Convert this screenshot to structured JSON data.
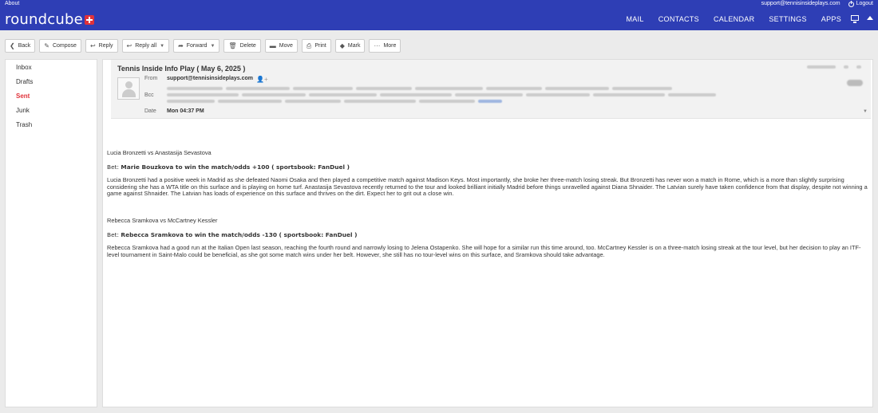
{
  "topbar": {
    "about": "About",
    "user_email": "support@tennisinsideplays.com",
    "logout": "Logout"
  },
  "header": {
    "logo": "roundcube",
    "nav": [
      "MAIL",
      "CONTACTS",
      "CALENDAR",
      "SETTINGS",
      "APPS"
    ]
  },
  "toolbar": [
    {
      "label": "Back",
      "icon": "back-arrow-icon",
      "glyph": "❮",
      "dropdown": false
    },
    {
      "label": "Compose",
      "icon": "pencil-icon",
      "glyph": "✎",
      "dropdown": false
    },
    {
      "label": "Reply",
      "icon": "reply-icon",
      "glyph": "↩",
      "dropdown": false
    },
    {
      "label": "Reply all",
      "icon": "reply-all-icon",
      "glyph": "↩",
      "dropdown": true
    },
    {
      "label": "Forward",
      "icon": "forward-icon",
      "glyph": "➦",
      "dropdown": true
    },
    {
      "label": "Delete",
      "icon": "trash-icon",
      "glyph": "🗑",
      "dropdown": false
    },
    {
      "label": "Move",
      "icon": "folder-icon",
      "glyph": "▬",
      "dropdown": false
    },
    {
      "label": "Print",
      "icon": "printer-icon",
      "glyph": "⎙",
      "dropdown": false
    },
    {
      "label": "Mark",
      "icon": "tag-icon",
      "glyph": "◆",
      "dropdown": false
    },
    {
      "label": "More",
      "icon": "ellipsis-icon",
      "glyph": "···",
      "dropdown": false
    }
  ],
  "folders": [
    {
      "label": "Inbox",
      "active": false
    },
    {
      "label": "Drafts",
      "active": false
    },
    {
      "label": "Sent",
      "active": true
    },
    {
      "label": "Junk",
      "active": false
    },
    {
      "label": "Trash",
      "active": false
    }
  ],
  "message": {
    "subject": "Tennis Inside Info Play ( May 6, 2025 )",
    "from_label": "From",
    "from": "support@tennisinsideplays.com",
    "bcc_label": "Bcc",
    "date_label": "Date",
    "date": "Mon 04:37 PM",
    "accent": "#e0323a",
    "header_color": "#2e3eb5"
  },
  "body": {
    "match1_title": "Lucia Bronzetti vs Anastasija Sevastova",
    "match1_bet_label": "Bet:",
    "match1_bet": "Marie Bouzkova to win the match/odds +100 ( sportsbook: FanDuel )",
    "match1_text": "Lucia Bronzetti had a positive week in Madrid as she defeated Naomi Osaka and then played a competitive match against Madison Keys. Most importantly, she broke her three-match losing streak. But Bronzetti has never won a match in Rome, which is a more than slightly surprising considering she has a WTA title on this surface and is playing on home turf. Anastasija Sevastova recently returned to the tour and looked brilliant initially Madrid before things unravelled against Diana Shnaider. The Latvian surely have taken confidence from that display, despite not winning a game against Shnaider. The Latvian has loads of experience on this surface and thrives on the dirt. Expect her to grit out a close win.",
    "match2_title": "Rebecca Sramkova vs McCartney Kessler",
    "match2_bet_label": "Bet:",
    "match2_bet": "Rebecca Sramkova to win the match/odds -130 ( sportsbook: FanDuel )",
    "match2_text": "Rebecca Sramkova had a good run at the Italian Open last season, reaching the fourth round and narrowly losing to Jelena Ostapenko. She will hope for a similar run this time around, too. McCartney Kessler is on a three-match losing streak at the tour level, but her decision to play an ITF-level tournament in Saint-Malo could be beneficial, as she got some match wins under her belt. However, she still has no tour-level wins on this surface, and Sramkova should take advantage."
  }
}
